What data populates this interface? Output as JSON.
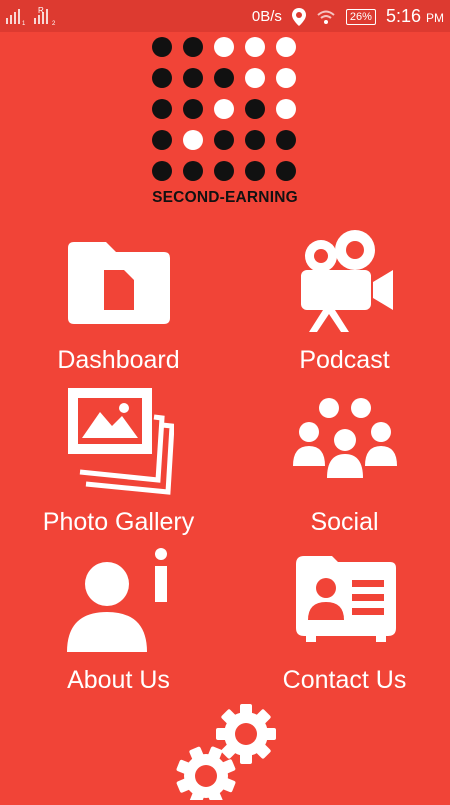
{
  "status_bar": {
    "network_speed": "0B/s",
    "battery": "26%",
    "time": "5:16",
    "ampm": "PM",
    "icons": [
      "signal-icon",
      "signal-roaming-icon",
      "location-icon",
      "wifi-icon",
      "battery-icon"
    ]
  },
  "logo": {
    "text": "SECOND-EARNING",
    "grid": [
      [
        "b",
        "b",
        "w",
        "w",
        "w"
      ],
      [
        "b",
        "b",
        "b",
        "w",
        "w"
      ],
      [
        "b",
        "b",
        "w",
        "b",
        "w"
      ],
      [
        "b",
        "w",
        "b",
        "b",
        "b"
      ],
      [
        "b",
        "b",
        "b",
        "b",
        "b"
      ]
    ],
    "colors": {
      "dark": "#111111",
      "light": "#ffffff"
    }
  },
  "menu": {
    "dashboard": "Dashboard",
    "podcast": "Podcast",
    "photo_gallery": "Photo Gallery",
    "social": "Social",
    "about_us": "About Us",
    "contact_us": "Contact Us"
  },
  "theme": {
    "background": "#f14437",
    "status_bar": "#dd3a30",
    "icon_color": "#ffffff"
  }
}
